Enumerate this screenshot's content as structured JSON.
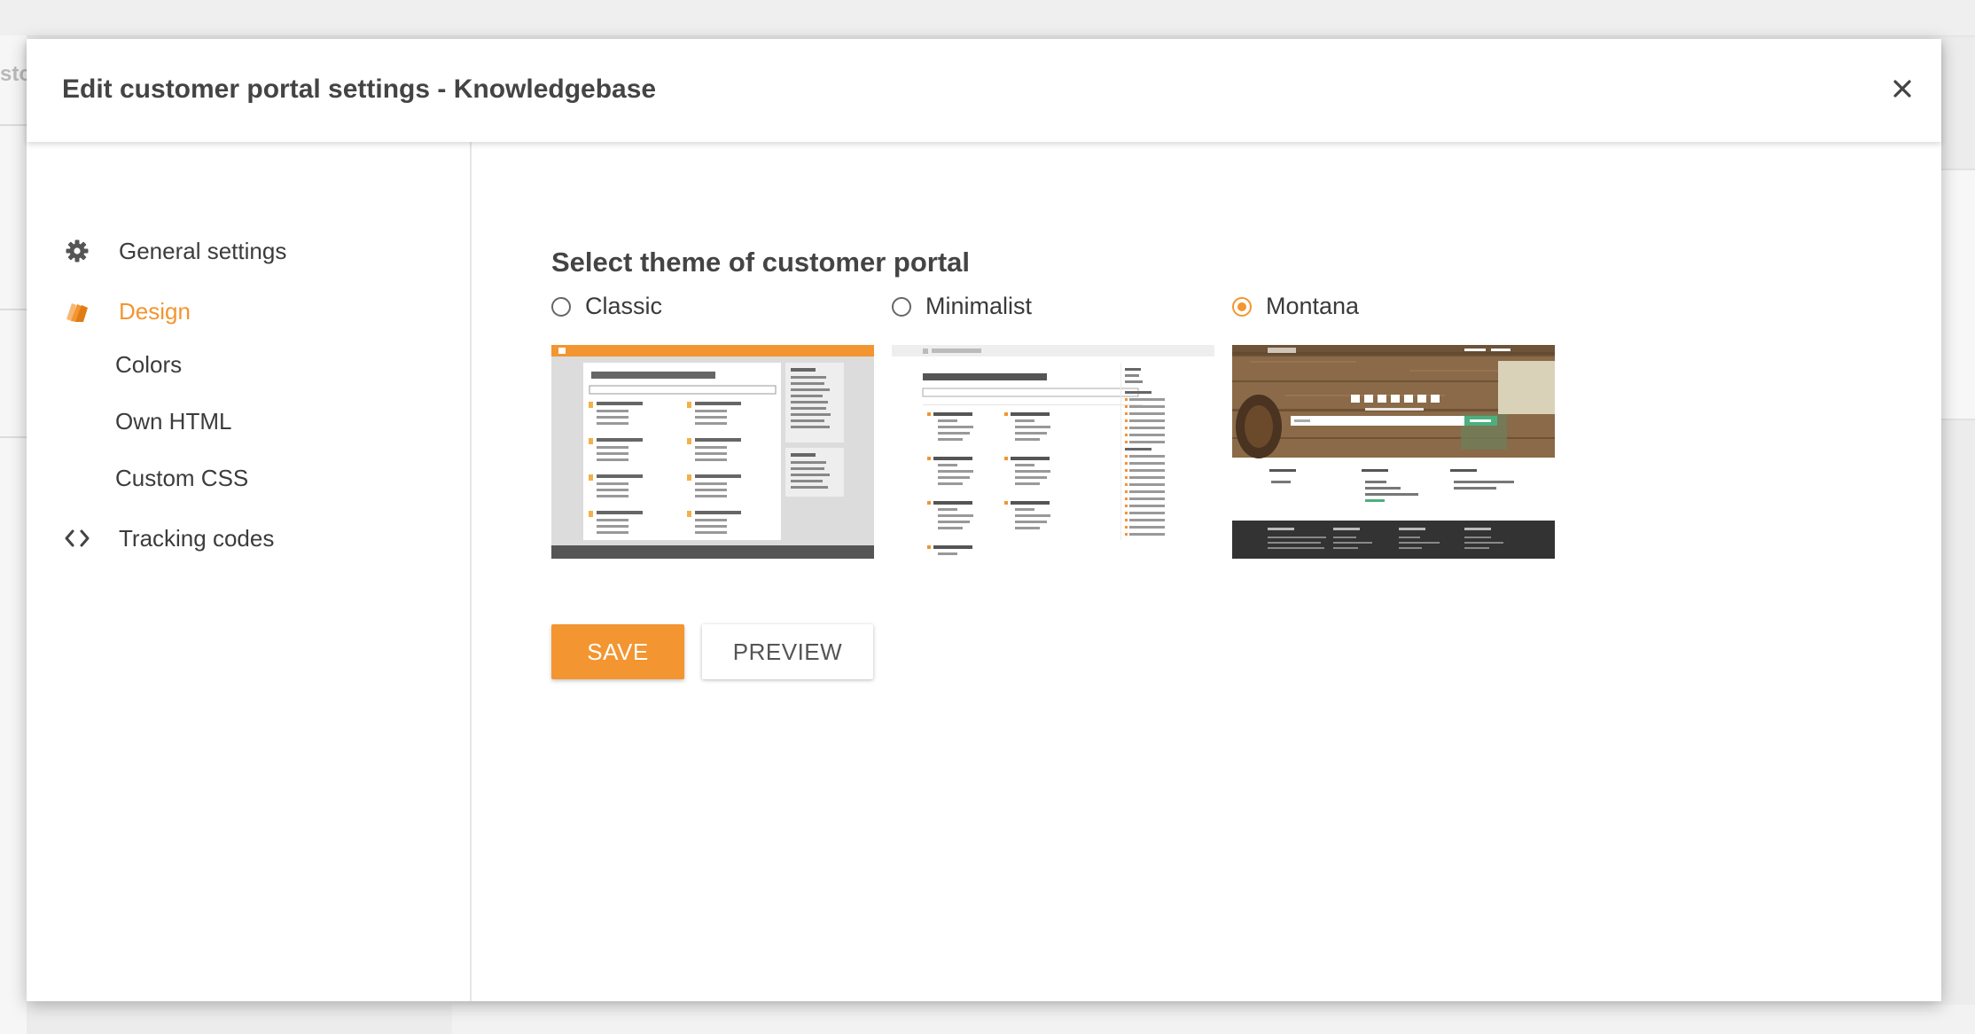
{
  "dialog": {
    "title": "Edit customer portal settings - Knowledgebase",
    "close_icon": "close-icon"
  },
  "background": {
    "fragment_text": "sto"
  },
  "sidebar": {
    "items": [
      {
        "label": "General settings",
        "icon": "gear-icon"
      },
      {
        "label": "Design",
        "icon": "paint-swatch-icon",
        "active": true
      },
      {
        "label": "Tracking codes",
        "icon": "code-brackets-icon"
      }
    ],
    "design_subitems": [
      "Colors",
      "Own HTML",
      "Custom CSS"
    ]
  },
  "main": {
    "section_title": "Select theme of customer portal",
    "themes": [
      {
        "label": "Classic",
        "selected": false
      },
      {
        "label": "Minimalist",
        "selected": false
      },
      {
        "label": "Montana",
        "selected": true
      }
    ],
    "save_label": "SAVE",
    "preview_label": "PREVIEW"
  },
  "colors": {
    "accent": "#f39530",
    "text": "#3c3c3c",
    "montana_green": "#4caf7d"
  }
}
